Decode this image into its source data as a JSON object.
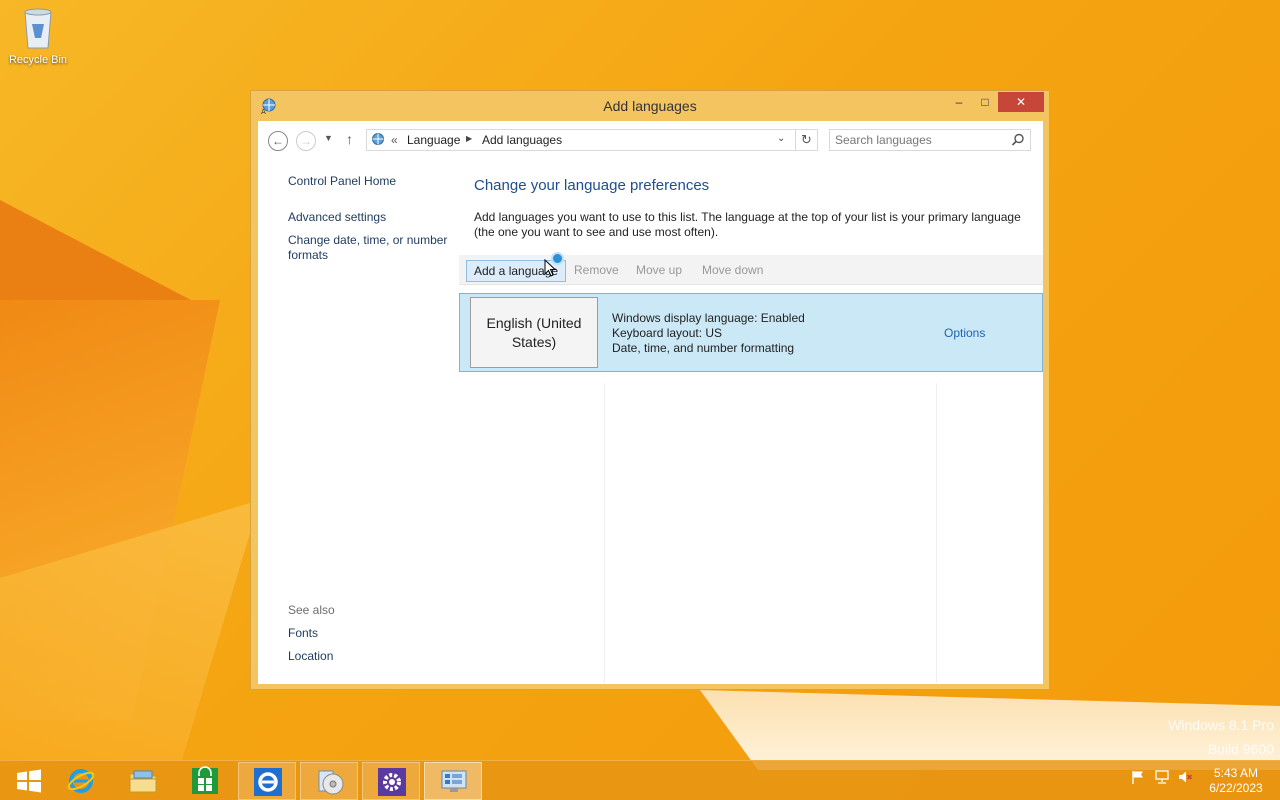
{
  "desktop": {
    "recycle_bin_label": "Recycle Bin",
    "watermark_line1": "Windows 8.1 Pro",
    "watermark_line2": "Build 9600"
  },
  "window": {
    "title": "Add languages",
    "minimize_glyph": "–",
    "maximize_glyph": "□",
    "close_glyph": "✕"
  },
  "address": {
    "back_glyph": "←",
    "forward_glyph": "→",
    "recent_glyph": "▼",
    "up_glyph": "↑",
    "overflow_glyph": "«",
    "crumbs": [
      "Language",
      "Add languages"
    ],
    "crumb_arrow": "▶",
    "dropdown_glyph": "⌄",
    "refresh_glyph": "↻",
    "search_placeholder": "Search languages"
  },
  "left_pane": {
    "home": "Control Panel Home",
    "advanced": "Advanced settings",
    "date_time": "Change date, time, or number formats",
    "see_also": "See also",
    "fonts": "Fonts",
    "location": "Location"
  },
  "main": {
    "title": "Change your language preferences",
    "description": "Add languages you want to use to this list. The language at the top of your list is your primary language (the one you want to see and use most often).",
    "toolbar": {
      "add": "Add a language",
      "remove": "Remove",
      "move_up": "Move up",
      "move_down": "Move down"
    },
    "languages": [
      {
        "name": "English (United States)",
        "display": "Windows display language: Enabled",
        "keyboard": "Keyboard layout: US",
        "formatting": "Date, time, and number formatting",
        "options": "Options"
      }
    ]
  },
  "taskbar": {
    "time": "5:43 AM",
    "date": "6/22/2023"
  },
  "colors": {
    "accent": "#f39a0b",
    "link": "#1f63b1",
    "heading": "#1f4e8c",
    "selection": "#cbe8f6",
    "close_button": "#c7463a"
  }
}
